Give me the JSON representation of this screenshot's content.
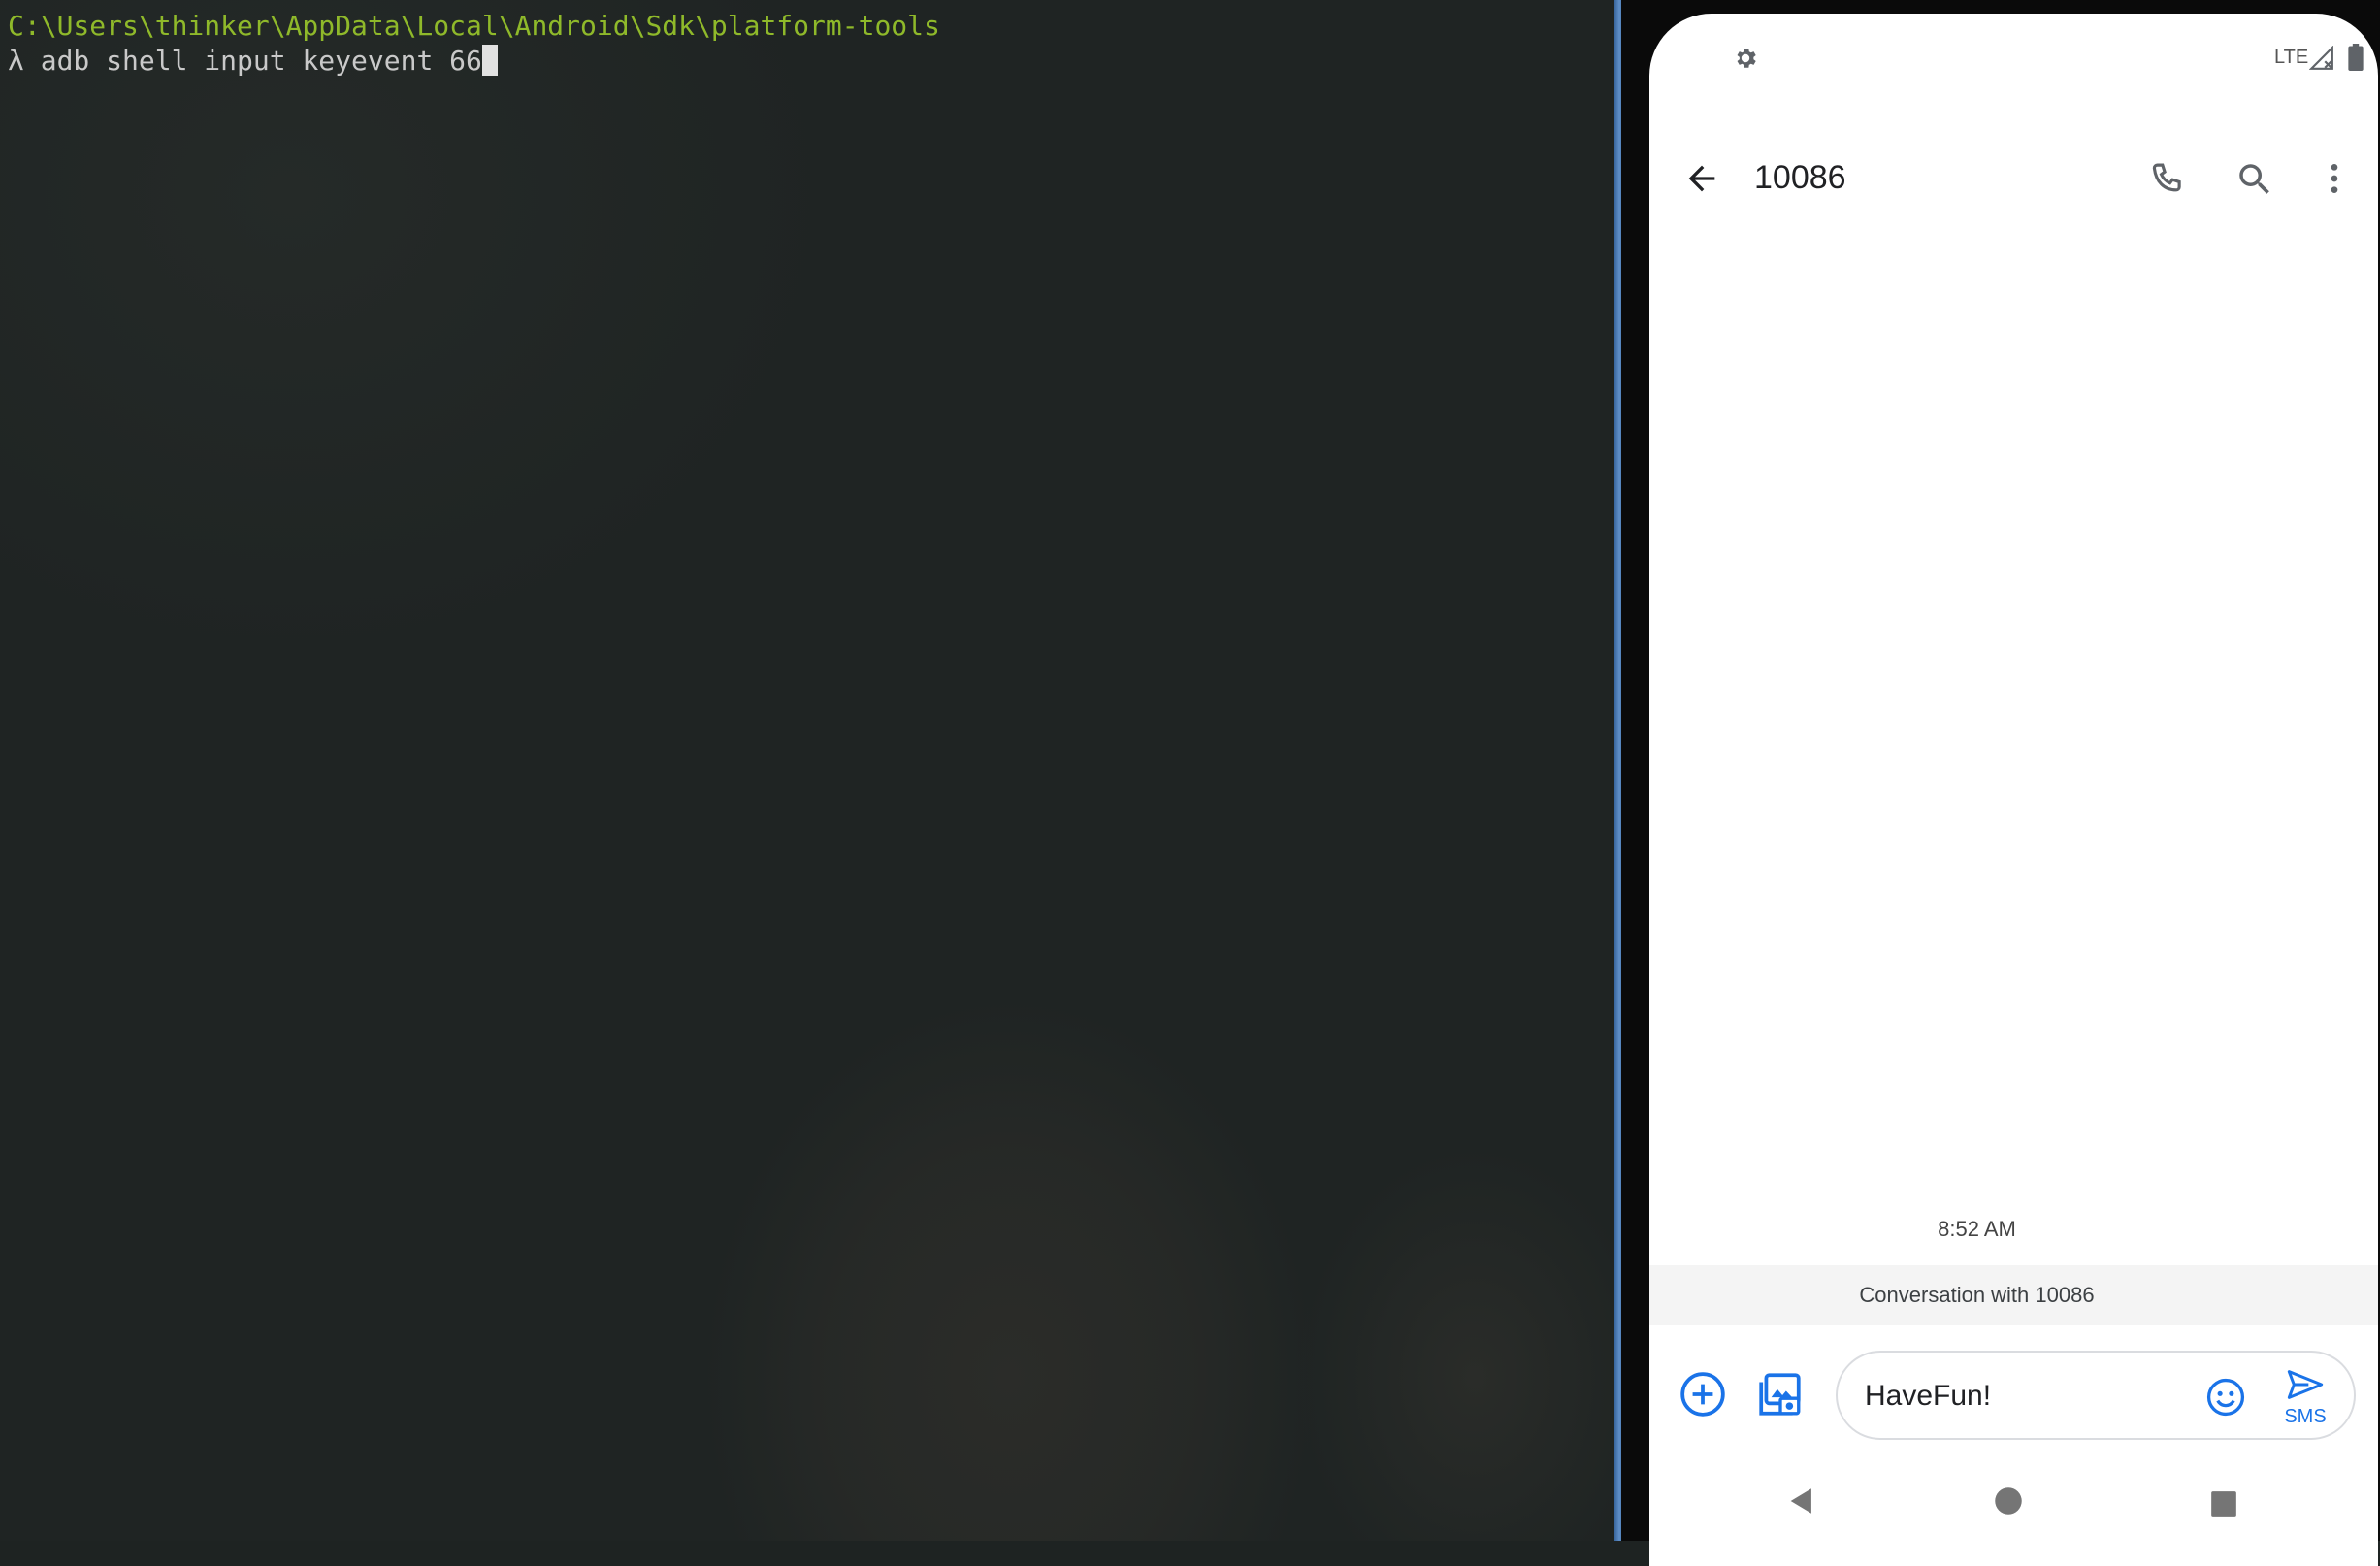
{
  "terminal": {
    "path": "C:\\Users\\thinker\\AppData\\Local\\Android\\Sdk\\platform-tools",
    "prompt": "λ",
    "command": "adb shell input keyevent 66"
  },
  "phone": {
    "status_bar": {
      "network": "LTE",
      "icons": [
        "settings-icon",
        "signal-icon",
        "battery-icon"
      ]
    },
    "app_bar": {
      "title": "10086",
      "icons": [
        "back-arrow-icon",
        "phone-icon",
        "search-icon",
        "more-vert-icon"
      ]
    },
    "conversation": {
      "timestamp": "8:52 AM",
      "banner": "Conversation with 10086"
    },
    "compose": {
      "text": "HaveFun!",
      "send_label": "SMS",
      "accent": "#1a73e8",
      "icons": [
        "add-circle-icon",
        "gallery-icon",
        "emoji-icon",
        "send-icon"
      ]
    },
    "nav_bar": {
      "icons": [
        "nav-back-icon",
        "nav-home-icon",
        "nav-recents-icon"
      ]
    }
  }
}
